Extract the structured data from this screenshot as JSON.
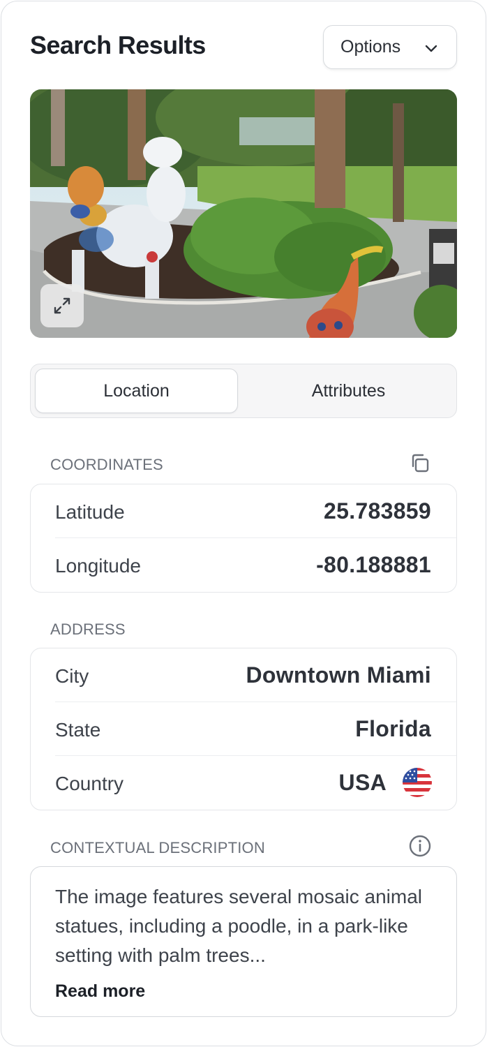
{
  "header": {
    "title": "Search Results",
    "options_label": "Options"
  },
  "photo": {
    "alt": "Mosaic poodle statue in a park",
    "expand_icon": "expand-icon"
  },
  "tabs": [
    {
      "label": "Location",
      "active": true
    },
    {
      "label": "Attributes",
      "active": false
    }
  ],
  "coordinates": {
    "label": "COORDINATES",
    "copy_icon": "copy-icon",
    "rows": [
      {
        "key": "Latitude",
        "value": "25.783859"
      },
      {
        "key": "Longitude",
        "value": "-80.188881"
      }
    ]
  },
  "address": {
    "label": "ADDRESS",
    "rows": [
      {
        "key": "City",
        "value": "Downtown Miami"
      },
      {
        "key": "State",
        "value": "Florida"
      },
      {
        "key": "Country",
        "value": "USA",
        "flag": "us-flag-icon"
      }
    ]
  },
  "description": {
    "label": "CONTEXTUAL DESCRIPTION",
    "info_icon": "info-icon",
    "text": "The image features several mosaic animal statues, including a poodle, in a park-like setting with palm trees...",
    "read_more": "Read more"
  }
}
